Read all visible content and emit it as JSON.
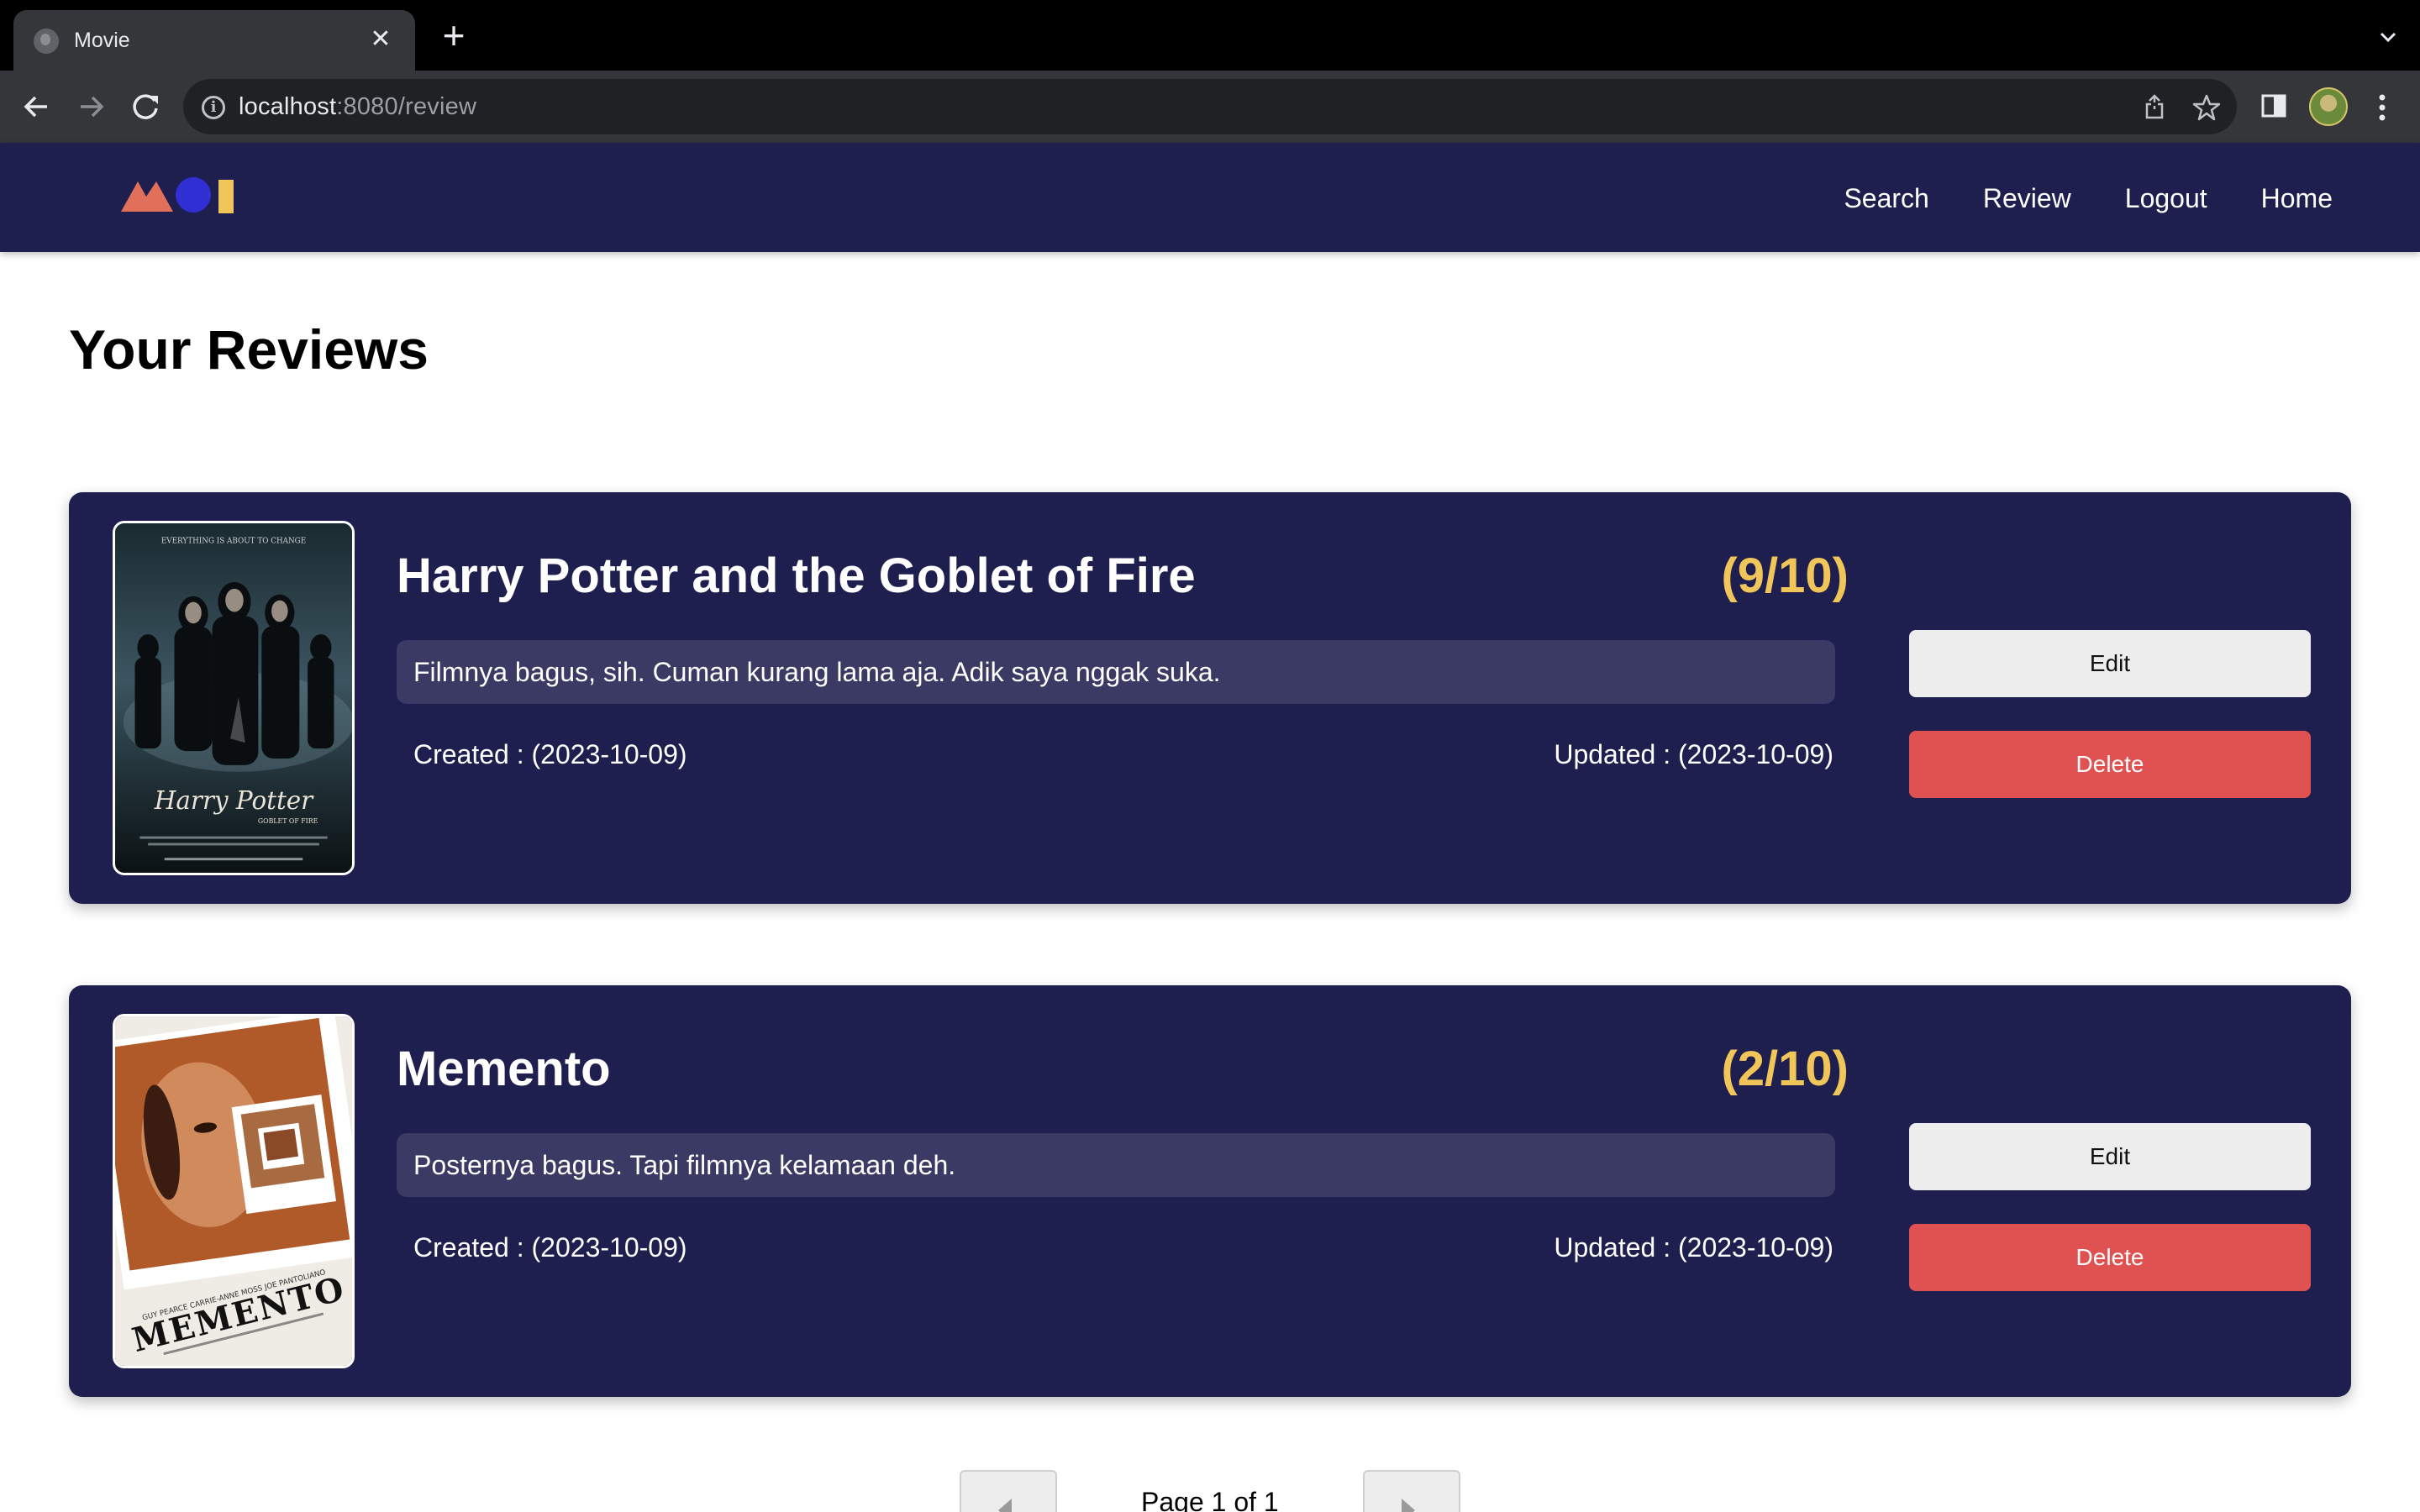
{
  "browser": {
    "tab_title": "Movie",
    "url_host": "localhost",
    "url_rest": ":8080/review"
  },
  "navbar": {
    "logo_colors": [
      "#e0705a",
      "#2f2fd4",
      "#f0c65a"
    ],
    "links": [
      "Search",
      "Review",
      "Logout",
      "Home"
    ]
  },
  "page": {
    "title": "Your Reviews"
  },
  "reviews": [
    {
      "title": "Harry Potter and the Goblet of Fire",
      "rating": "(9/10)",
      "comment": "Filmnya bagus, sih. Cuman kurang lama aja. Adik saya nggak suka.",
      "created": "Created : (2023-10-09)",
      "updated": "Updated : (2023-10-09)",
      "edit_label": "Edit",
      "delete_label": "Delete",
      "poster_caption": "Harry Potter"
    },
    {
      "title": "Memento",
      "rating": "(2/10)",
      "comment": "Posternya bagus. Tapi filmnya kelamaan deh.",
      "created": "Created : (2023-10-09)",
      "updated": "Updated : (2023-10-09)",
      "edit_label": "Edit",
      "delete_label": "Delete",
      "poster_caption": "MEMENTO"
    }
  ],
  "pagination": {
    "label": "Page 1 of 1"
  }
}
